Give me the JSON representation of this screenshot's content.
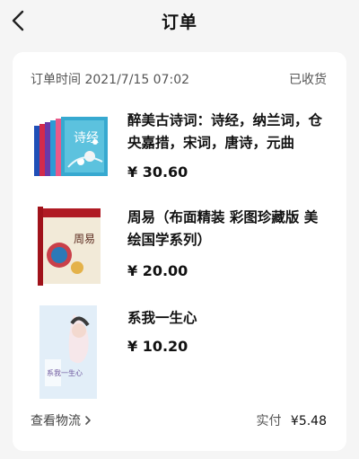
{
  "header": {
    "title": "订单"
  },
  "order": {
    "time_label": "订单时间 2021/7/15 07:02",
    "status": "已收货"
  },
  "items": [
    {
      "title": "醉美古诗词：诗经，纳兰词，仓央嘉措，宋词，唐诗，元曲",
      "price": "¥ 30.60",
      "cover_text": "诗经"
    },
    {
      "title": "周易（布面精装 彩图珍藏版 美绘国学系列）",
      "price": "¥ 20.00",
      "cover_text": "周易"
    },
    {
      "title": "系我一生心",
      "price": "¥ 10.20",
      "cover_text": "系我一生心"
    }
  ],
  "footer": {
    "logistics_label": "查看物流",
    "paid_label": "实付",
    "paid_amount": "¥5.48"
  },
  "colors": {
    "background": "#f5f5f5",
    "card": "#ffffff",
    "text": "#111111",
    "muted": "#555555"
  },
  "icons": {
    "back": "chevron-left-icon",
    "logistics_arrow": "chevron-right-icon"
  }
}
